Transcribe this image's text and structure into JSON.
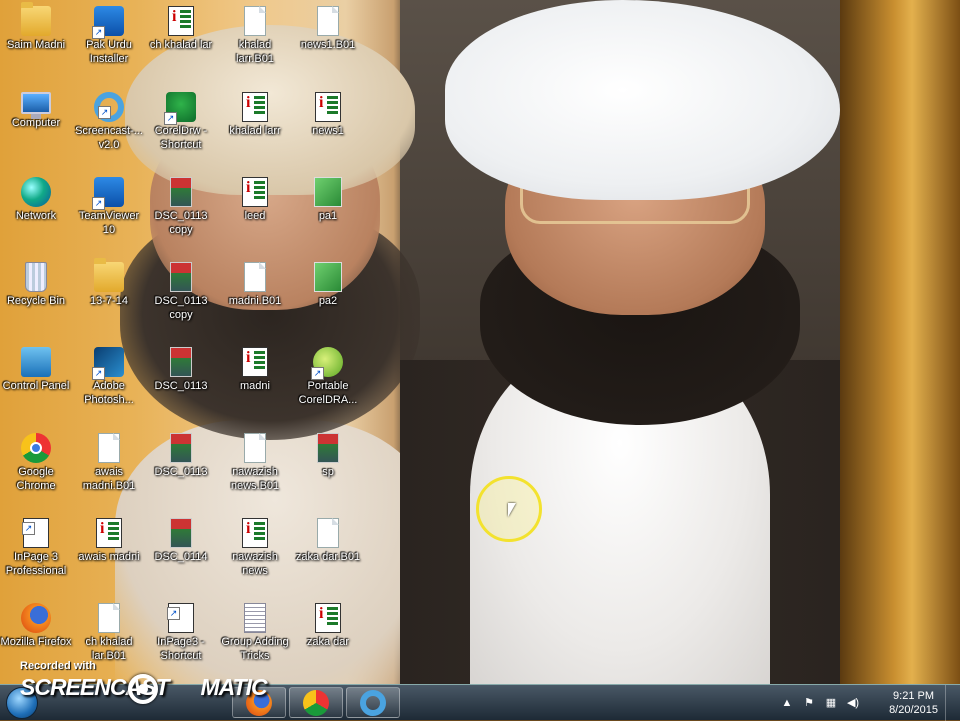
{
  "desktop": {
    "icons": [
      {
        "label": "Saim Madni",
        "icon": "folder-icon"
      },
      {
        "label": "Pak Urdu Installer",
        "icon": "installer-icon"
      },
      {
        "label": "ch khalad lar",
        "icon": "inpage-document-icon"
      },
      {
        "label": "khalad larr.B01",
        "icon": "file-icon"
      },
      {
        "label": "news1.B01",
        "icon": "file-icon"
      },
      {
        "label": "Computer",
        "icon": "computer-icon"
      },
      {
        "label": "Screencast-... v2.0",
        "icon": "screencast-icon"
      },
      {
        "label": "CorelDrw - Shortcut",
        "icon": "coreldraw-icon"
      },
      {
        "label": "khalad larr",
        "icon": "inpage-document-icon"
      },
      {
        "label": "news1",
        "icon": "inpage-document-icon"
      },
      {
        "label": "Network",
        "icon": "network-icon"
      },
      {
        "label": "TeamViewer 10",
        "icon": "teamviewer-icon"
      },
      {
        "label": "DSC_0113 copy",
        "icon": "photo-icon"
      },
      {
        "label": "leed",
        "icon": "inpage-document-icon"
      },
      {
        "label": "pa1",
        "icon": "image-icon"
      },
      {
        "label": "Recycle Bin",
        "icon": "recycle-bin-icon"
      },
      {
        "label": "13-7-14",
        "icon": "folder-icon"
      },
      {
        "label": "DSC_0113 copy",
        "icon": "photo-icon"
      },
      {
        "label": "madni.B01",
        "icon": "file-icon"
      },
      {
        "label": "pa2",
        "icon": "image-icon"
      },
      {
        "label": "Control Panel",
        "icon": "control-panel-icon"
      },
      {
        "label": "Adobe Photosh...",
        "icon": "photoshop-icon"
      },
      {
        "label": "DSC_0113",
        "icon": "photo-icon"
      },
      {
        "label": "madni",
        "icon": "inpage-document-icon"
      },
      {
        "label": "Portable CorelDRA...",
        "icon": "coreldraw-portable-icon"
      },
      {
        "label": "Google Chrome",
        "icon": "chrome-icon"
      },
      {
        "label": "awais madni.B01",
        "icon": "file-icon"
      },
      {
        "label": "DSC_0113",
        "icon": "photo-icon"
      },
      {
        "label": "nawazish news.B01",
        "icon": "file-icon"
      },
      {
        "label": "sp",
        "icon": "photo-icon"
      },
      {
        "label": "InPage 3 Professional",
        "icon": "inpage-app-icon"
      },
      {
        "label": "awais madni",
        "icon": "inpage-document-icon"
      },
      {
        "label": "DSC_0114",
        "icon": "photo-icon"
      },
      {
        "label": "nawazish news",
        "icon": "inpage-document-icon"
      },
      {
        "label": "zaka dar.B01",
        "icon": "file-icon"
      },
      {
        "label": "Mozilla Firefox",
        "icon": "firefox-icon"
      },
      {
        "label": "ch khalad lar.B01",
        "icon": "file-icon"
      },
      {
        "label": "InPage3 - Shortcut",
        "icon": "inpage-app-icon"
      },
      {
        "label": "Group Adding Tricks",
        "icon": "text-file-icon"
      },
      {
        "label": "zaka dar",
        "icon": "inpage-document-icon"
      }
    ]
  },
  "watermark": {
    "line1": "Recorded with",
    "line2": "SCREENCAST",
    "line3": "MATIC"
  },
  "taskbar": {
    "pinned": [
      {
        "name": "firefox",
        "icon": "firefox-icon"
      },
      {
        "name": "chrome",
        "icon": "chrome-icon"
      },
      {
        "name": "screencast",
        "icon": "screencast-icon"
      }
    ],
    "tray": {
      "time": "9:21 PM",
      "date": "8/20/2015"
    }
  }
}
